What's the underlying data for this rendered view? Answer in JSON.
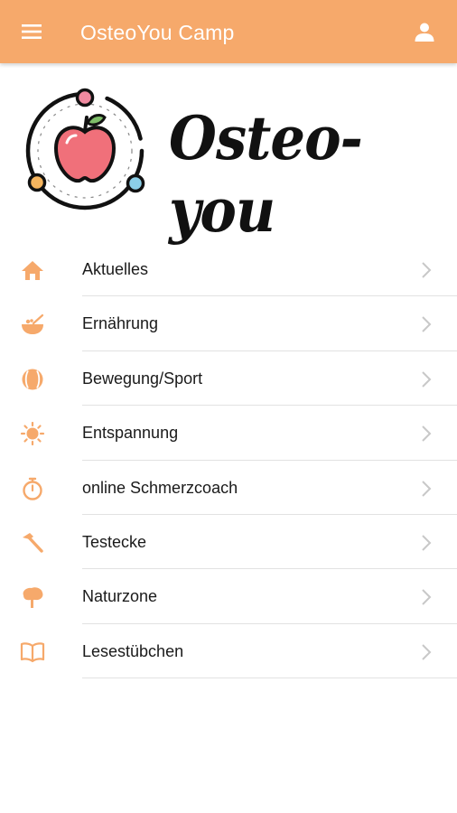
{
  "appbar": {
    "title": "OsteoYou Camp",
    "menu_icon": "hamburger-menu-icon",
    "profile_icon": "person-icon",
    "background": "#f6a96b"
  },
  "logo": {
    "text": "Osteo-you",
    "icon": "apple-orbit-logo"
  },
  "accent_color": "#f6a96b",
  "menu": {
    "items": [
      {
        "label": "Aktuelles",
        "icon": "home-icon"
      },
      {
        "label": "Ernährung",
        "icon": "bowl-icon"
      },
      {
        "label": "Bewegung/Sport",
        "icon": "baseball-icon"
      },
      {
        "label": "Entspannung",
        "icon": "sun-icon"
      },
      {
        "label": "online Schmerzcoach",
        "icon": "stopwatch-icon"
      },
      {
        "label": "Testecke",
        "icon": "hammer-icon"
      },
      {
        "label": "Naturzone",
        "icon": "tree-icon"
      },
      {
        "label": "Lesestübchen",
        "icon": "book-icon"
      }
    ],
    "chevron_icon": "chevron-right-icon"
  }
}
